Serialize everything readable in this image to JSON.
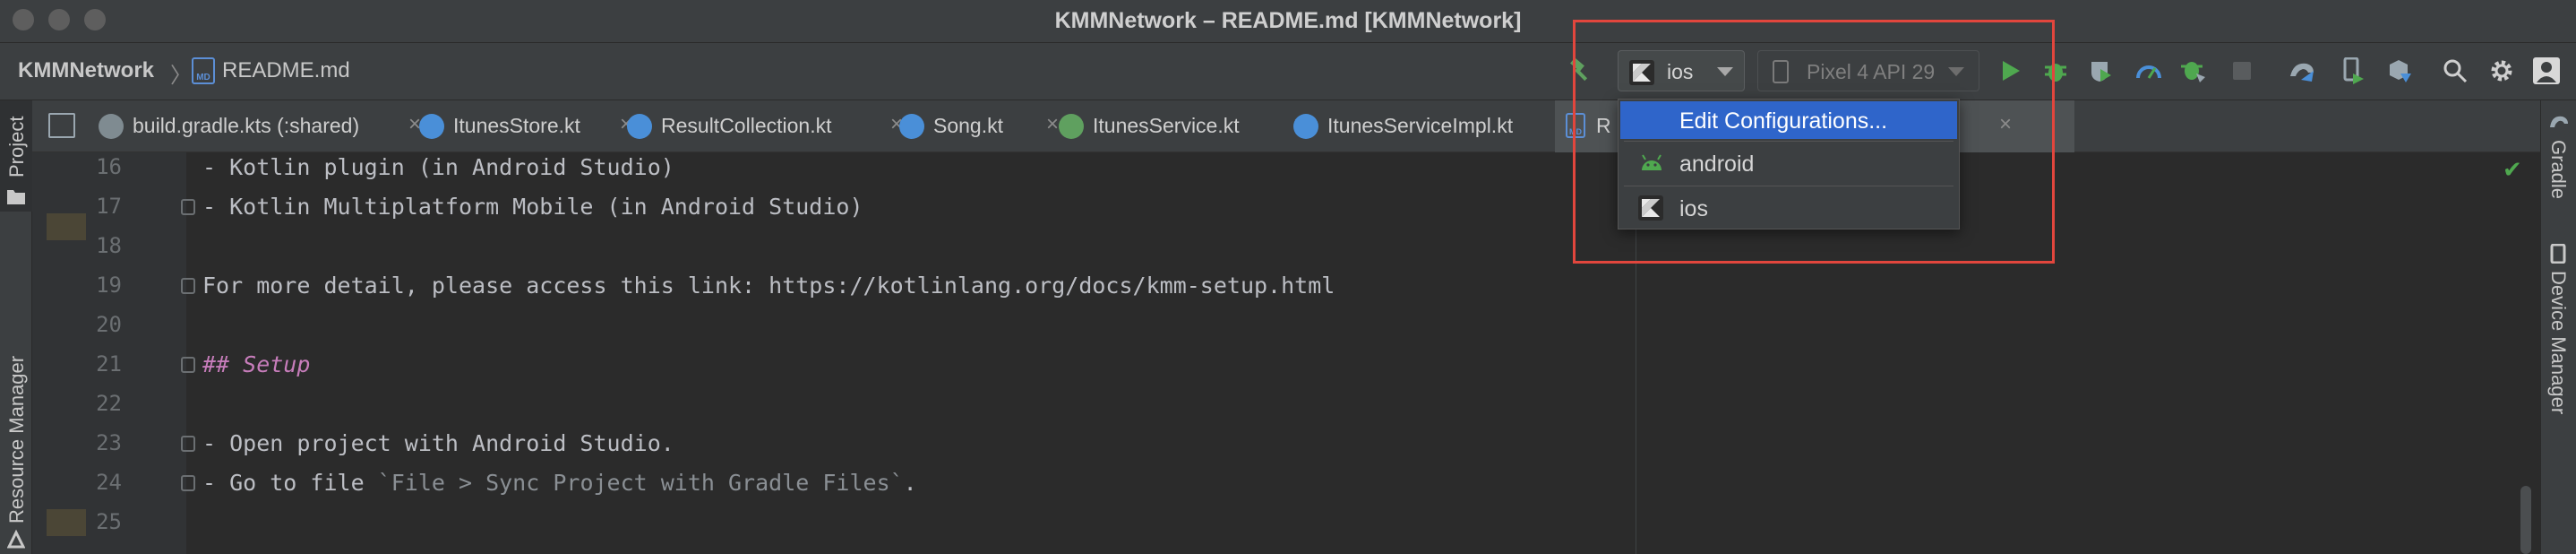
{
  "window": {
    "title": "KMMNetwork – README.md [KMMNetwork]"
  },
  "breadcrumb": {
    "project": "KMMNetwork",
    "separator": "〉",
    "file": "README.md",
    "file_icon_text": "MD"
  },
  "toolbar": {
    "run_config": "ios",
    "device": "Pixel 4 API 29",
    "icons": [
      "hammer-icon",
      "run-icon",
      "debug-icon",
      "coverage-icon",
      "profile-icon",
      "attach-debugger-icon",
      "stop-icon",
      "gradle-sync-icon",
      "device-manager-icon",
      "sdk-manager-icon",
      "search-icon",
      "settings-icon",
      "account-icon"
    ]
  },
  "config_menu": {
    "items": [
      {
        "label": "Edit Configurations...",
        "selected": true
      },
      {
        "label": "android",
        "icon": "android-icon"
      },
      {
        "label": "ios",
        "icon": "kotlin-icon"
      }
    ]
  },
  "tool_windows": {
    "left_top": "Project",
    "left_bottom": "Resource Manager",
    "right_top": "Gradle",
    "right_bottom": "Device Manager"
  },
  "tabs": [
    {
      "label": "build.gradle.kts (:shared)",
      "icon_color": "#7f8b91"
    },
    {
      "label": "ItunesStore.kt",
      "icon_color": "#4a8fd8"
    },
    {
      "label": "ResultCollection.kt",
      "icon_color": "#4a8fd8"
    },
    {
      "label": "Song.kt",
      "icon_color": "#4a8fd8"
    },
    {
      "label": "ItunesService.kt",
      "icon_color": "#5fa05f"
    },
    {
      "label": "ItunesServiceImpl.kt",
      "icon_color": "#4a8fd8"
    },
    {
      "label": "R",
      "icon_text": "MD",
      "active": true
    }
  ],
  "editor": {
    "lines": [
      {
        "num": "16",
        "text": "- Kotlin plugin (in Android Studio)"
      },
      {
        "num": "17",
        "text": "- Kotlin Multiplatform Mobile (in Android Studio)"
      },
      {
        "num": "18",
        "text": ""
      },
      {
        "num": "19",
        "text": "For more detail, please access this link: https://kotlinlang.org/docs/kmm-setup.html"
      },
      {
        "num": "20",
        "text": ""
      },
      {
        "num": "21",
        "text": "## Setup",
        "style": "heading"
      },
      {
        "num": "22",
        "text": ""
      },
      {
        "num": "23",
        "text": "- Open project with Android Studio."
      },
      {
        "num": "24",
        "text": "- Go to file ",
        "inline_code": "`File > Sync Project with Gradle Files`",
        "tail": "."
      },
      {
        "num": "25",
        "text": ""
      }
    ]
  },
  "colors": {
    "accent": "#2f65ca",
    "highlight": "#e2463d",
    "run_green": "#4fa84f",
    "heading": "#c77dbb"
  }
}
